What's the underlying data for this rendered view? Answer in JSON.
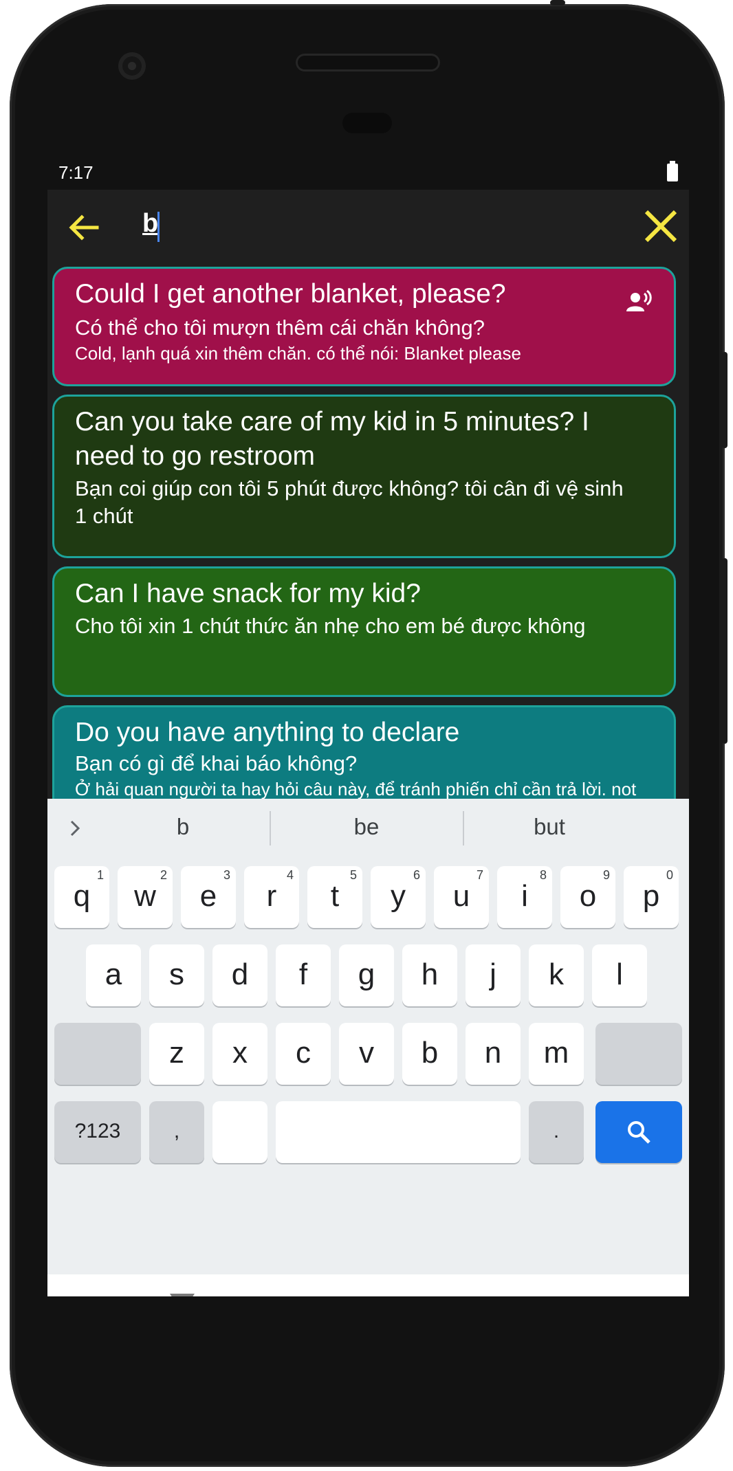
{
  "status_bar": {
    "time": "7:17"
  },
  "search": {
    "query": "b"
  },
  "cards": [
    {
      "english": "Could I get another blanket, please?",
      "vietnamese": "Có thể cho tôi mượn thêm cái chăn không?",
      "note": "Cold, lạnh quá xin thêm chăn. có thể nói: Blanket please",
      "color": "#a0104a"
    },
    {
      "english": "Can you take care of my kid in 5 minutes? I need to go restroom",
      "vietnamese": "Bạn coi giúp con tôi 5 phút được không? tôi cân đi vệ sinh 1 chút",
      "note": "",
      "color": "#1f3a12"
    },
    {
      "english": "Can I have snack for my kid?",
      "vietnamese": "Cho tôi xin 1 chút thức ăn nhẹ cho em bé được không",
      "note": "",
      "color": "#236615"
    },
    {
      "english": "Do you have anything to declare",
      "vietnamese": "Bạn có gì để khai báo không?",
      "note": "Ở hải quan người ta hay hỏi câu này, để tránh phiến chỉ cần trả lời. not much, just coffee, clothes, etc.",
      "color": "#0d7c80"
    }
  ],
  "keyboard": {
    "suggestions": [
      "b",
      "be",
      "but"
    ],
    "row1": [
      "q",
      "w",
      "e",
      "r",
      "t",
      "y",
      "u",
      "i",
      "o",
      "p"
    ],
    "row1_hints": [
      "1",
      "2",
      "3",
      "4",
      "5",
      "6",
      "7",
      "8",
      "9",
      "0"
    ],
    "row2": [
      "a",
      "s",
      "d",
      "f",
      "g",
      "h",
      "j",
      "k",
      "l"
    ],
    "row3": [
      "z",
      "x",
      "c",
      "v",
      "b",
      "n",
      "m"
    ],
    "symbols_label": "?123",
    "comma_label": ",",
    "period_label": "."
  },
  "colors": {
    "accent": "#f5e642",
    "key_search": "#1a73e8",
    "card_border": "#1da39b"
  }
}
